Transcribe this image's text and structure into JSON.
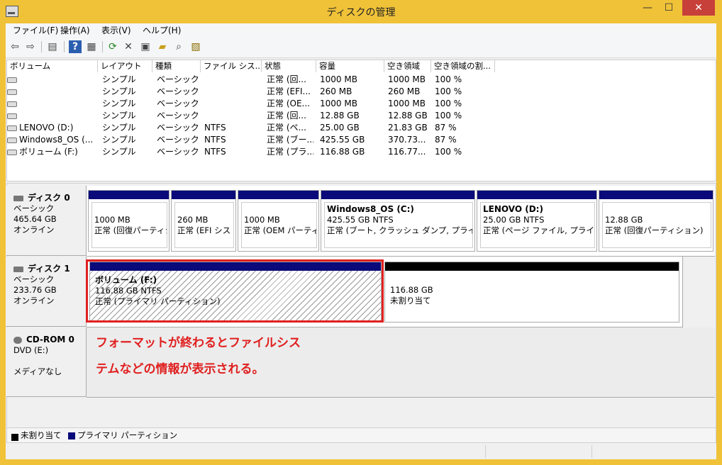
{
  "window": {
    "title": "ディスクの管理",
    "minimize": "—",
    "maximize": "☐",
    "close": "✕"
  },
  "menu": [
    "ファイル(F)",
    "操作(A)",
    "表示(V)",
    "ヘルプ(H)"
  ],
  "toolbar_icons": [
    "back-arrow-icon",
    "forward-arrow-icon",
    "console-tree-icon",
    "help-icon",
    "show-pane-icon",
    "refresh-icon",
    "delete-icon",
    "properties-icon",
    "open-icon",
    "explore-icon",
    "help-topic-icon"
  ],
  "list": {
    "columns": [
      "ボリューム",
      "レイアウト",
      "種類",
      "ファイル シス...",
      "状態",
      "容量",
      "空き領域",
      "空き領域の割..."
    ],
    "rows": [
      [
        "",
        "シンプル",
        "ベーシック",
        "",
        "正常 (回...",
        "1000 MB",
        "1000 MB",
        "100 %"
      ],
      [
        "",
        "シンプル",
        "ベーシック",
        "",
        "正常 (EFI...",
        "260 MB",
        "260 MB",
        "100 %"
      ],
      [
        "",
        "シンプル",
        "ベーシック",
        "",
        "正常 (OE...",
        "1000 MB",
        "1000 MB",
        "100 %"
      ],
      [
        "",
        "シンプル",
        "ベーシック",
        "",
        "正常 (回...",
        "12.88 GB",
        "12.88 GB",
        "100 %"
      ],
      [
        "LENOVO (D:)",
        "シンプル",
        "ベーシック",
        "NTFS",
        "正常 (ペ...",
        "25.00 GB",
        "21.83 GB",
        "87 %"
      ],
      [
        "Windows8_OS (...",
        "シンプル",
        "ベーシック",
        "NTFS",
        "正常 (ブー...",
        "425.55 GB",
        "370.73...",
        "87 %"
      ],
      [
        "ボリューム (F:)",
        "シンプル",
        "ベーシック",
        "NTFS",
        "正常 (プラ...",
        "116.88 GB",
        "116.77...",
        "100 %"
      ]
    ]
  },
  "disks": {
    "disk0": {
      "name": "ディスク 0",
      "type": "ベーシック",
      "size": "465.64 GB",
      "state": "オンライン",
      "partitions": [
        {
          "name": "",
          "size": "1000 MB",
          "status": "正常 (回復パーティシ"
        },
        {
          "name": "",
          "size": "260 MB",
          "status": "正常 (EFI シス"
        },
        {
          "name": "",
          "size": "1000 MB",
          "status": "正常 (OEM パーティ"
        },
        {
          "name": "Windows8_OS  (C:)",
          "size": "425.55 GB NTFS",
          "status": "正常 (ブート, クラッシュ ダンプ, プライマリ パ"
        },
        {
          "name": "LENOVO  (D:)",
          "size": "25.00 GB NTFS",
          "status": "正常 (ページ ファイル, プライマリ"
        },
        {
          "name": "",
          "size": "12.88 GB",
          "status": "正常 (回復パーティション)"
        }
      ]
    },
    "disk1": {
      "name": "ディスク 1",
      "type": "ベーシック",
      "size": "233.76 GB",
      "state": "オンライン",
      "partitions": [
        {
          "name": "ボリューム  (F:)",
          "size": "116.88 GB NTFS",
          "status": "正常 (プライマリ パーティション)"
        },
        {
          "name": "",
          "size": "116.88 GB",
          "status": "未割り当て"
        }
      ]
    },
    "cdrom0": {
      "name": "CD-ROM 0",
      "type": "DVD (E:)",
      "media": "メディアなし"
    }
  },
  "annotation": {
    "line1": "フォーマットが終わるとファイルシス",
    "line2": "テムなどの情報が表示される。",
    "color": "#e02020"
  },
  "legend": {
    "unallocated": "未割り当て",
    "primary": "プライマリ パーティション",
    "unallocated_color": "#000000",
    "primary_color": "#0a0a7a"
  }
}
